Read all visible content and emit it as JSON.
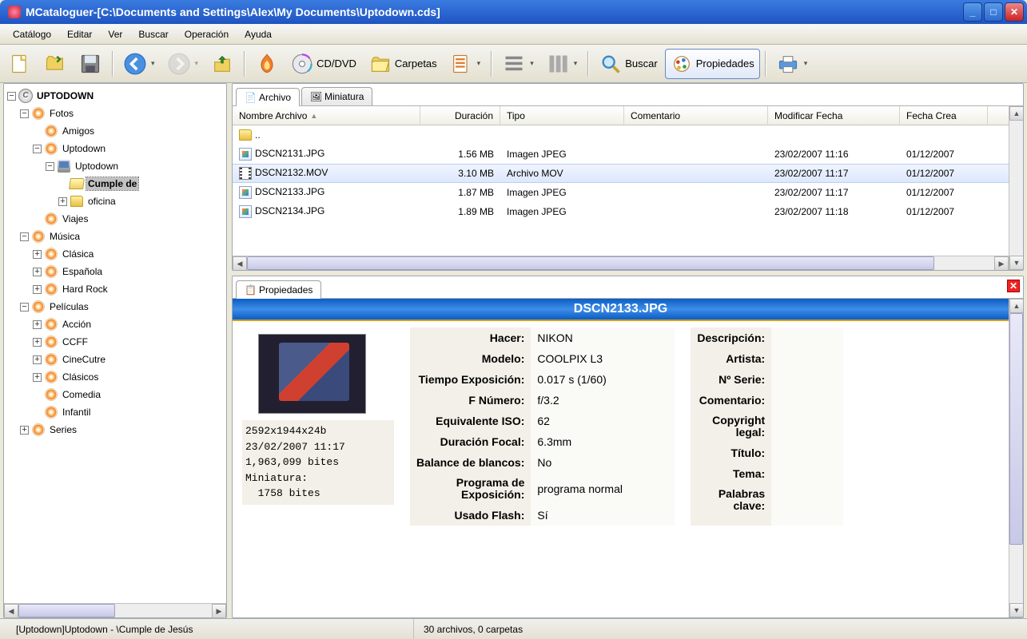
{
  "window": {
    "title": "MCataloguer-[C:\\Documents and Settings\\Alex\\My Documents\\Uptodown.cds]"
  },
  "menu": {
    "items": [
      "Catálogo",
      "Editar",
      "Ver",
      "Buscar",
      "Operación",
      "Ayuda"
    ]
  },
  "toolbar": {
    "cd_dvd_label": "CD/DVD",
    "carpetas_label": "Carpetas",
    "buscar_label": "Buscar",
    "propiedades_label": "Propiedades"
  },
  "tree": {
    "root": "UPTODOWN",
    "fotos": "Fotos",
    "amigos": "Amigos",
    "uptodown1": "Uptodown",
    "uptodown2": "Uptodown",
    "cumple": "Cumple de",
    "oficina": "oficina",
    "viajes": "Viajes",
    "musica": "Música",
    "clasica": "Clásica",
    "espanola": "Española",
    "hardrock": "Hard Rock",
    "peliculas": "Películas",
    "accion": "Acción",
    "ccff": "CCFF",
    "cinecutre": "CineCutre",
    "clasicos": "Clásicos",
    "comedia": "Comedia",
    "infantil": "Infantil",
    "series": "Series"
  },
  "tabs": {
    "archivo": "Archivo",
    "miniatura": "Miniatura"
  },
  "columns": {
    "nombre": "Nombre Archivo",
    "duracion": "Duración",
    "tipo": "Tipo",
    "comentario": "Comentario",
    "modificar": "Modificar Fecha",
    "fecha_crea": "Fecha Crea"
  },
  "files": {
    "up": "..",
    "row1": {
      "name": "DSCN2131.JPG",
      "size": "1.56 MB",
      "type": "Imagen JPEG",
      "mod": "23/02/2007 11:16",
      "crea": "01/12/2007"
    },
    "row2": {
      "name": "DSCN2132.MOV",
      "size": "3.10 MB",
      "type": "Archivo MOV",
      "mod": "23/02/2007 11:17",
      "crea": "01/12/2007"
    },
    "row3": {
      "name": "DSCN2133.JPG",
      "size": "1.87 MB",
      "type": "Imagen JPEG",
      "mod": "23/02/2007 11:17",
      "crea": "01/12/2007"
    },
    "row4": {
      "name": "DSCN2134.JPG",
      "size": "1.89 MB",
      "type": "Imagen JPEG",
      "mod": "23/02/2007 11:18",
      "crea": "01/12/2007"
    }
  },
  "propTab": "Propiedades",
  "prop": {
    "title": "DSCN2133.JPG",
    "thumb_meta1": "2592x1944x24b",
    "thumb_meta2": "23/02/2007 11:17",
    "thumb_meta3": "1,963,099 bites",
    "thumb_meta4": "Miniatura:",
    "thumb_meta5": "  1758 bites",
    "k_hacer": "Hacer:",
    "v_hacer": "NIKON",
    "k_modelo": "Modelo:",
    "v_modelo": "COOLPIX L3",
    "k_expo": "Tiempo Exposición:",
    "v_expo": "0.017 s  (1/60)",
    "k_fnum": "F Número:",
    "v_fnum": "f/3.2",
    "k_iso": "Equivalente ISO:",
    "v_iso": "62",
    "k_focal": "Duración Focal:",
    "v_focal": "6.3mm",
    "k_wb": "Balance de blancos:",
    "v_wb": "No",
    "k_prog": "Programa de Exposición:",
    "v_prog": "programa normal",
    "k_flash": "Usado Flash:",
    "v_flash": "Sí",
    "k_desc": "Descripción:",
    "v_desc": "",
    "k_art": "Artista:",
    "v_art": "",
    "k_serie": "Nº Serie:",
    "v_serie": "",
    "k_com": "Comentario:",
    "v_com": "",
    "k_copy": "Copyright legal:",
    "v_copy": "",
    "k_tit": "Título:",
    "v_tit": "",
    "k_tema": "Tema:",
    "v_tema": "",
    "k_pal": "Palabras clave:",
    "v_pal": ""
  },
  "status": {
    "path": "[Uptodown]Uptodown - \\Cumple de Jesús",
    "count": "30 archivos, 0 carpetas"
  }
}
